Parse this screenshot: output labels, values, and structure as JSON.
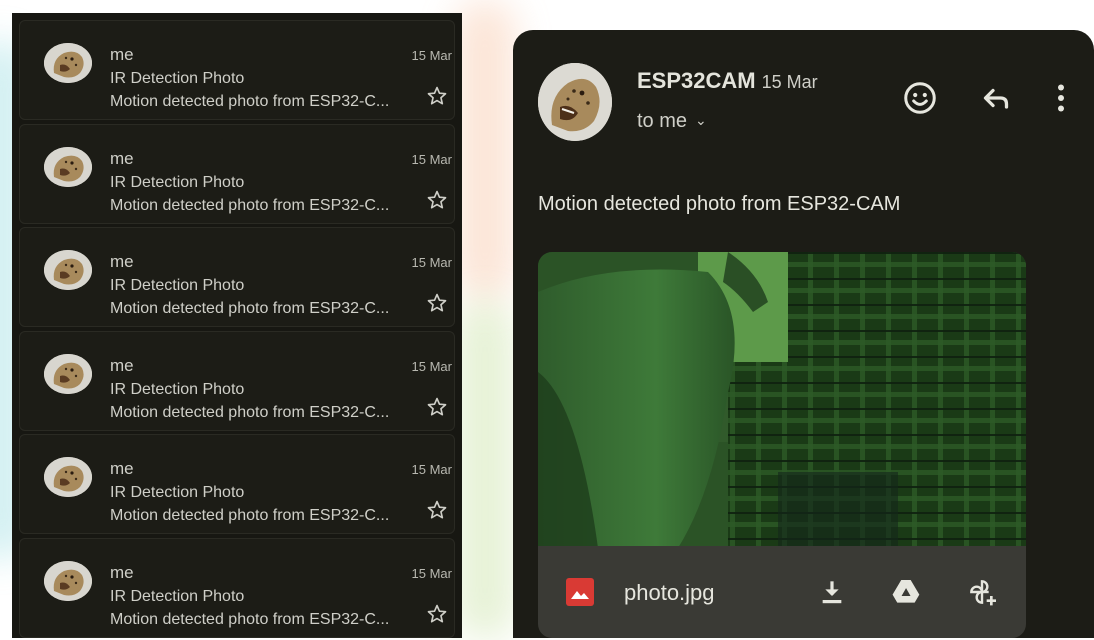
{
  "inbox": {
    "items": [
      {
        "sender": "me",
        "date": "15 Mar",
        "subject": "IR Detection Photo",
        "snippet": "Motion detected photo from ESP32-C..."
      },
      {
        "sender": "me",
        "date": "15 Mar",
        "subject": "IR Detection Photo",
        "snippet": "Motion detected photo from ESP32-C..."
      },
      {
        "sender": "me",
        "date": "15 Mar",
        "subject": "IR Detection Photo",
        "snippet": "Motion detected photo from ESP32-C..."
      },
      {
        "sender": "me",
        "date": "15 Mar",
        "subject": "IR Detection Photo",
        "snippet": "Motion detected photo from ESP32-C..."
      },
      {
        "sender": "me",
        "date": "15 Mar",
        "subject": "IR Detection Photo",
        "snippet": "Motion detected photo from ESP32-C..."
      },
      {
        "sender": "me",
        "date": "15 Mar",
        "subject": "IR Detection Photo",
        "snippet": "Motion detected photo from ESP32-C..."
      }
    ]
  },
  "message": {
    "sender": "ESP32CAM",
    "date": "15 Mar",
    "recipient": "to me",
    "recipient_chevron": "⌄",
    "body": "Motion detected photo from ESP32-CAM",
    "icons": [
      "emoji-icon",
      "reply-icon",
      "more-vert-icon"
    ],
    "attachment": {
      "file_name": "photo.jpg",
      "actions": [
        "download-icon",
        "drive-icon",
        "add-to-photos-icon"
      ]
    }
  },
  "colors": {
    "panel_bg": "#1c1c16",
    "text": "#cfcfc8",
    "attachment_bar": "#3a3a35",
    "image_file_icon": "#d93a34"
  }
}
